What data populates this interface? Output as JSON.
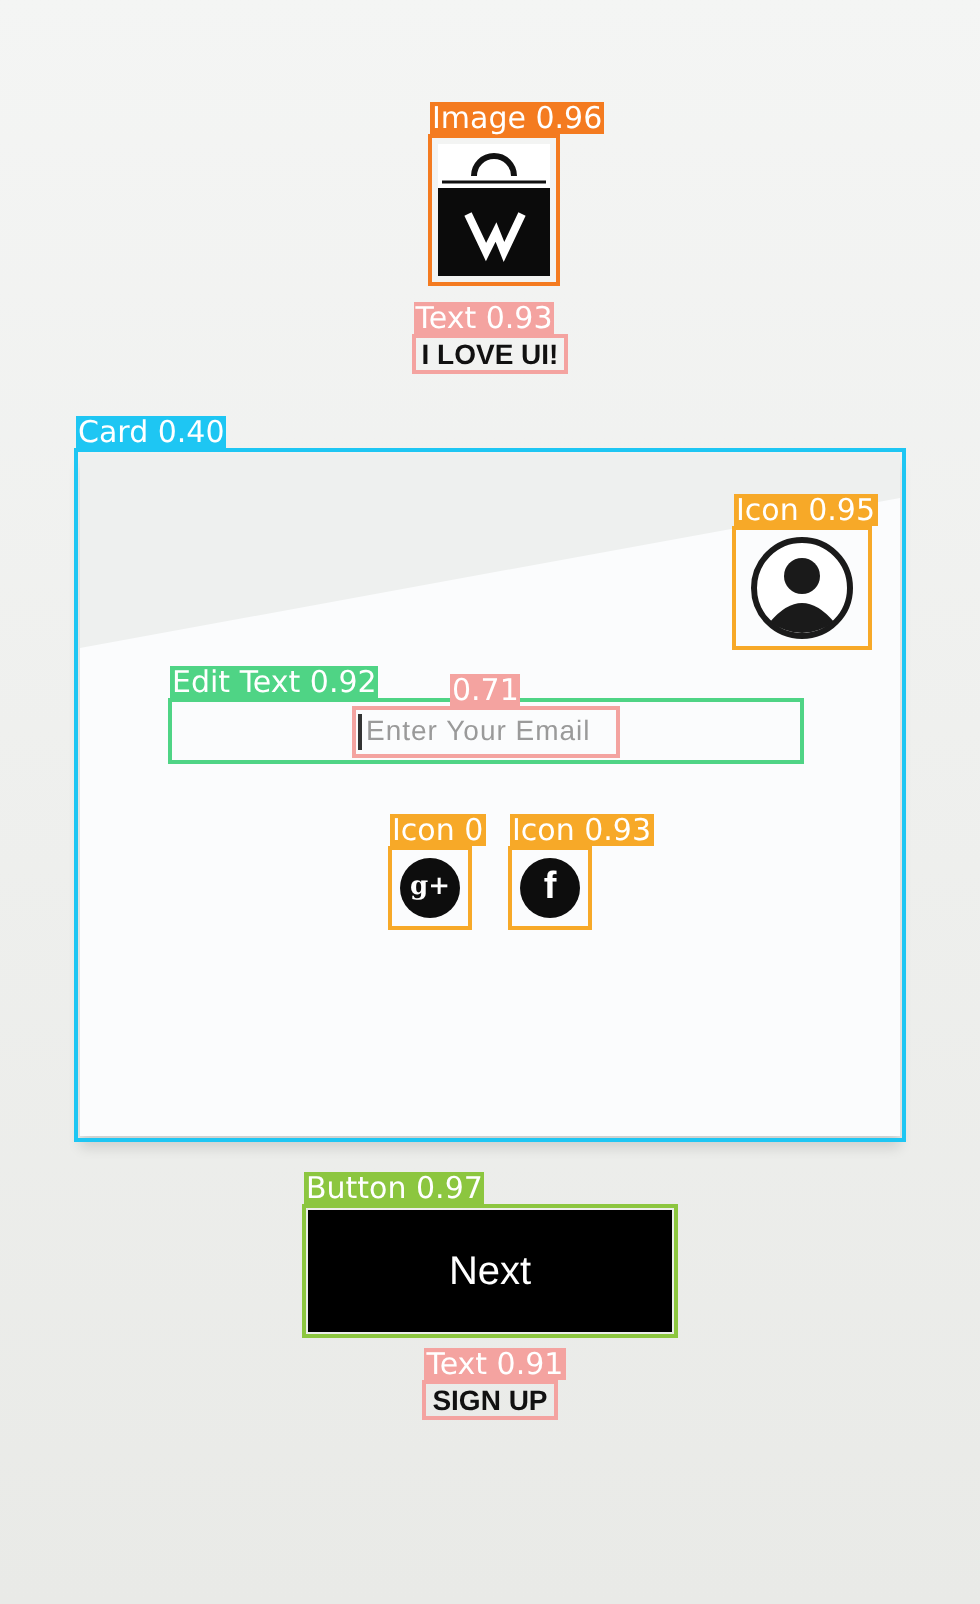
{
  "logo": {
    "detection": {
      "label": "Image 0.96",
      "color": "#f47b20"
    }
  },
  "caption": {
    "text": "I LOVE UI!",
    "detection": {
      "label": "Text 0.93",
      "color": "#f4a3a0"
    }
  },
  "card": {
    "detection": {
      "label": "Card 0.40",
      "color": "#1ec6f3"
    },
    "avatar": {
      "detection": {
        "label": "Icon 0.95",
        "color": "#f7a928"
      }
    },
    "email": {
      "placeholder": "Enter Your Email",
      "detection": {
        "label": "Edit Text 0.92",
        "color": "#4fd485"
      },
      "text_detection": {
        "label": "0.71",
        "color": "#f4a3a0"
      }
    },
    "social": [
      {
        "kind": "google",
        "glyph": "g+",
        "detection": {
          "label": "Icon 0",
          "color": "#f7a928"
        }
      },
      {
        "kind": "facebook",
        "glyph": "f",
        "detection": {
          "label": "Icon 0.93",
          "color": "#f7a928"
        }
      }
    ]
  },
  "button": {
    "label": "Next",
    "detection": {
      "label": "Button 0.97",
      "color": "#8cc63f"
    }
  },
  "link": {
    "text": "SIGN UP",
    "detection": {
      "label": "Text 0.91",
      "color": "#f4a3a0"
    }
  }
}
